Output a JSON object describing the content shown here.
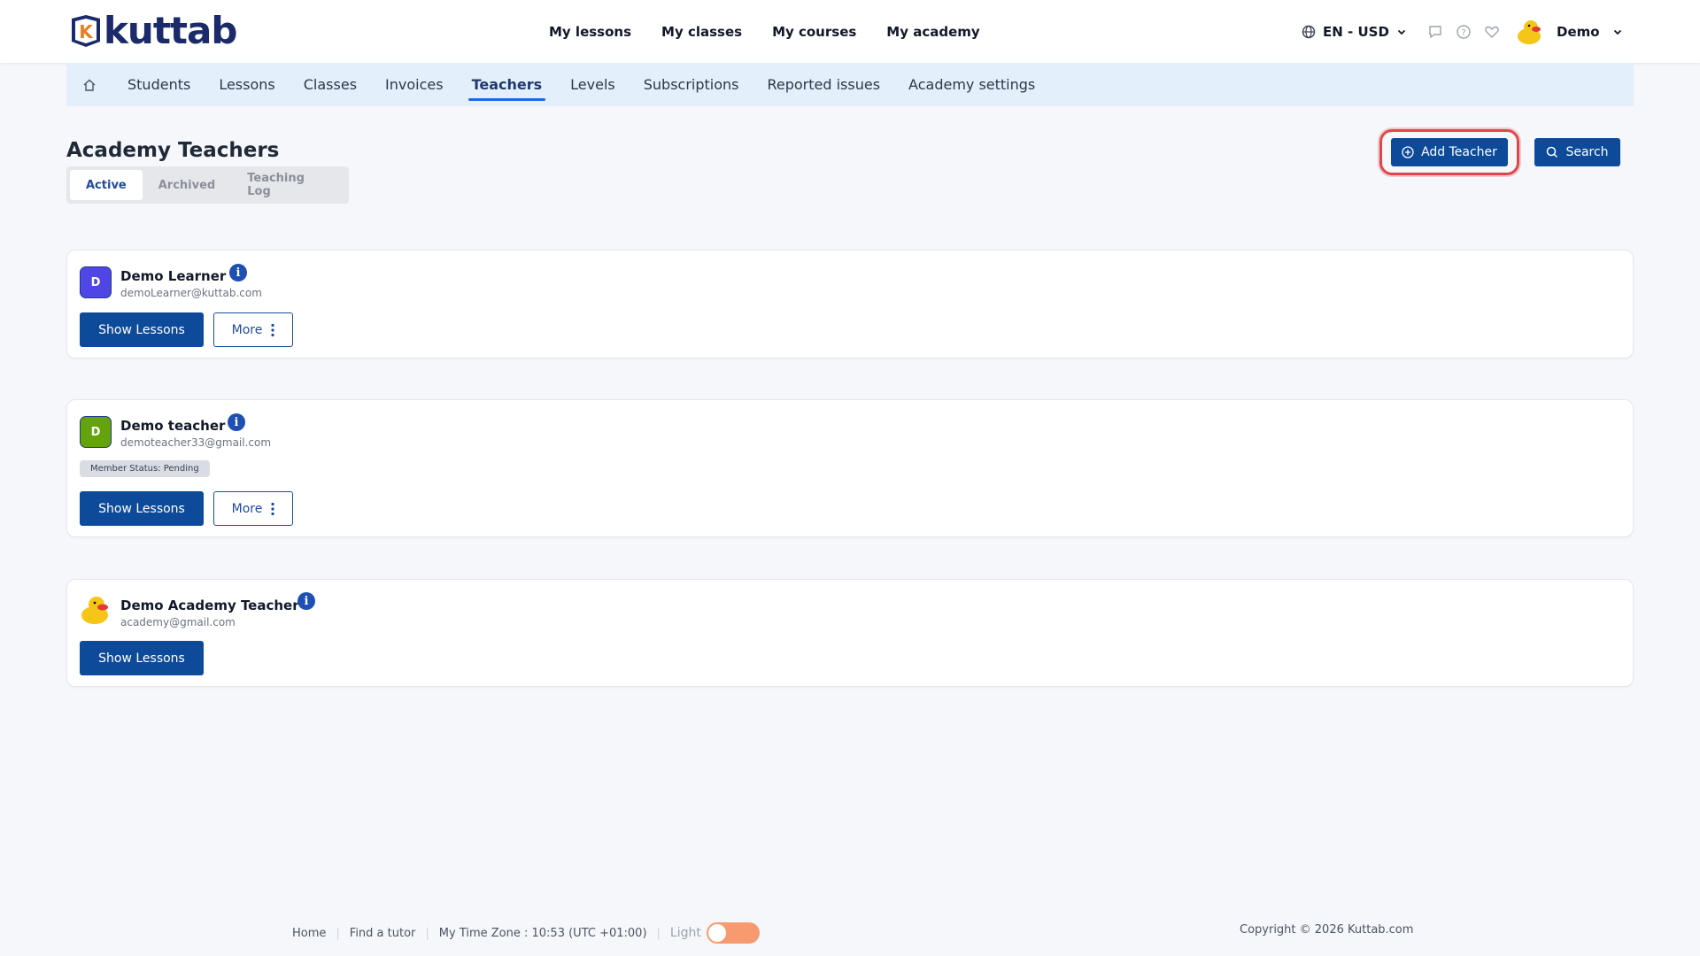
{
  "header": {
    "logo_text": "kuttab",
    "logo_badge_letter": "K",
    "nav": [
      "My lessons",
      "My classes",
      "My courses",
      "My academy"
    ],
    "language_currency": "EN - USD",
    "user_name": "Demo",
    "icons": [
      "globe-icon",
      "chat-icon",
      "help-icon",
      "heart-icon",
      "duck-avatar",
      "chevron-down-icon"
    ]
  },
  "subnav": {
    "items": [
      "Students",
      "Lessons",
      "Classes",
      "Invoices",
      "Teachers",
      "Levels",
      "Subscriptions",
      "Reported issues",
      "Academy settings"
    ],
    "active": "Teachers"
  },
  "page": {
    "title": "Academy Teachers",
    "tabs": [
      "Active",
      "Archived",
      "Teaching Log"
    ],
    "active_tab": "Active",
    "add_teacher_label": "Add Teacher",
    "search_label": "Search"
  },
  "teachers": [
    {
      "initial": "D",
      "name": "Demo Learner",
      "email": "demoLearner@kuttab.com",
      "avatar_color": "#4f46e5",
      "status_badge": "",
      "show_lessons": "Show Lessons",
      "more": "More"
    },
    {
      "initial": "D",
      "name": "Demo teacher",
      "email": "demoteacher33@gmail.com",
      "avatar_color": "#65a30d",
      "status_badge": "Member Status: Pending",
      "show_lessons": "Show Lessons",
      "more": "More"
    },
    {
      "initial": "",
      "name": "Demo Academy Teacher",
      "email": "academy@gmail.com",
      "avatar_color": "duck",
      "status_badge": "",
      "show_lessons": "Show Lessons",
      "more": ""
    }
  ],
  "footer": {
    "links": [
      "Home",
      "Find a tutor"
    ],
    "timezone": "My Time Zone : 10:53 (UTC +01:00)",
    "theme_label": "Light",
    "copyright": "Copyright © 2026 Kuttab.com"
  },
  "colors": {
    "primary": "#0d4a99",
    "subnav_bg": "#e4effc",
    "highlight_ring": "#e0474c",
    "toggle": "#f79a6f"
  }
}
